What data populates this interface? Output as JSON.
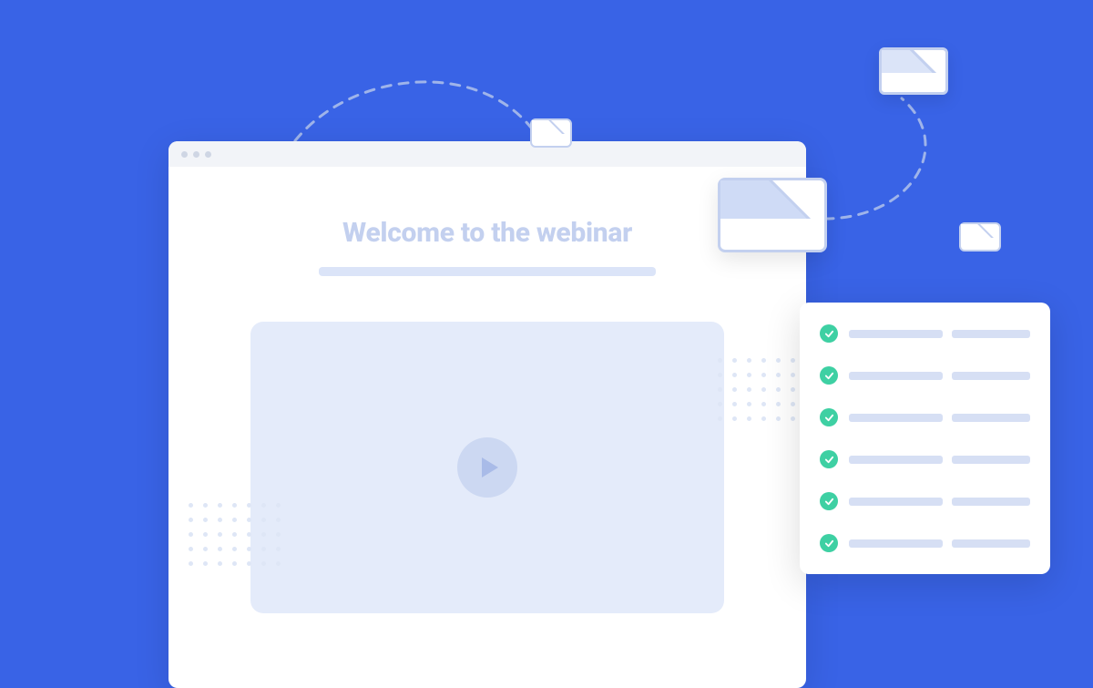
{
  "page": {
    "title": "Welcome to the webinar"
  },
  "checklist": {
    "item_count": 6
  },
  "icons": {
    "envelope": "envelope-icon",
    "play": "play-icon",
    "check": "check-icon"
  },
  "colors": {
    "background": "#3963e6",
    "accent_light": "#c3d0ef",
    "check_green": "#3ed0a3"
  }
}
